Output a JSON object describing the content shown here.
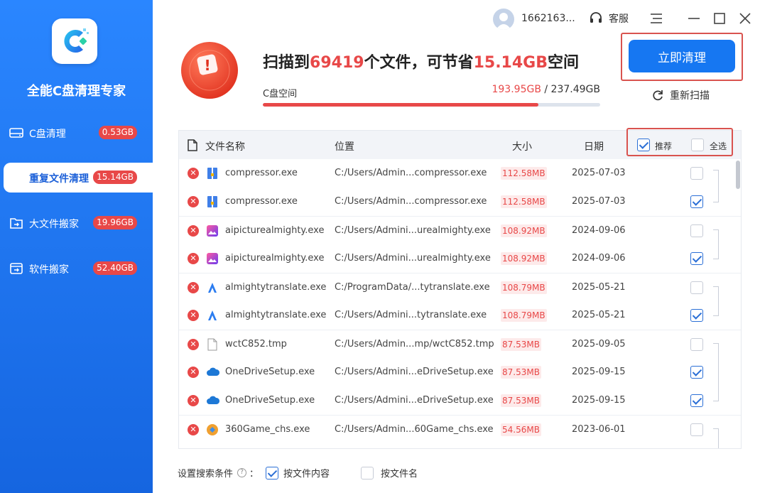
{
  "sidebar": {
    "app_name": "全能C盘清理专家",
    "items": [
      {
        "label": "C盘清理",
        "badge": "0.53GB"
      },
      {
        "label": "重复文件清理",
        "badge": "15.14GB"
      },
      {
        "label": "大文件搬家",
        "badge": "19.96GB"
      },
      {
        "label": "软件搬家",
        "badge": "52.40GB"
      }
    ]
  },
  "topbar": {
    "username": "1662163...",
    "service_label": "客服"
  },
  "summary": {
    "prefix": "扫描到",
    "file_count": "69419",
    "middle": "个文件，可节省",
    "saving": "15.14GB",
    "suffix": "空间",
    "disk_label": "C盘空间",
    "disk_used": "193.95GB",
    "disk_total": " / 237.49GB",
    "disk_fraction": 0.817,
    "clean_button": "立即清理",
    "rescan_label": "重新扫描"
  },
  "table": {
    "headers": {
      "name": "文件名称",
      "location": "位置",
      "size": "大小",
      "date": "日期",
      "recommend": "推荐",
      "select_all": "全选"
    },
    "rows": [
      {
        "name": "compressor.exe",
        "path": "C:/Users/Admin...compressor.exe",
        "size": "112.58MB",
        "date": "2025-07-03",
        "checked": false,
        "icon": "zip-icon"
      },
      {
        "name": "compressor.exe",
        "path": "C:/Users/Admin...compressor.exe",
        "size": "112.58MB",
        "date": "2025-07-03",
        "checked": true,
        "icon": "zip-icon"
      },
      {
        "name": "aipicturealmighty.exe",
        "path": "C:/Users/Admini...urealmighty.exe",
        "size": "108.92MB",
        "date": "2024-09-06",
        "checked": false,
        "icon": "picture-app-icon"
      },
      {
        "name": "aipicturealmighty.exe",
        "path": "C:/Users/Admini...urealmighty.exe",
        "size": "108.92MB",
        "date": "2024-09-06",
        "checked": true,
        "icon": "picture-app-icon"
      },
      {
        "name": "almightytranslate.exe",
        "path": "C:/ProgramData/...tytranslate.exe",
        "size": "108.79MB",
        "date": "2025-05-21",
        "checked": false,
        "icon": "translate-app-icon"
      },
      {
        "name": "almightytranslate.exe",
        "path": "C:/Users/Admini...tytranslate.exe",
        "size": "108.79MB",
        "date": "2025-05-21",
        "checked": true,
        "icon": "translate-app-icon"
      },
      {
        "name": "wctC852.tmp",
        "path": "C:/Users/Admin...mp/wctC852.tmp",
        "size": "87.53MB",
        "date": "2025-09-05",
        "checked": false,
        "icon": "blank-file-icon"
      },
      {
        "name": "OneDriveSetup.exe",
        "path": "C:/Users/Admini...eDriveSetup.exe",
        "size": "87.53MB",
        "date": "2025-09-15",
        "checked": true,
        "icon": "cloud-icon"
      },
      {
        "name": "OneDriveSetup.exe",
        "path": "C:/Users/Admini...eDriveSetup.exe",
        "size": "87.53MB",
        "date": "2025-09-15",
        "checked": true,
        "icon": "cloud-icon"
      },
      {
        "name": "360Game_chs.exe",
        "path": "C:/Users/Admin...60Game_chs.exe",
        "size": "54.56MB",
        "date": "2023-06-01",
        "checked": false,
        "icon": "game-icon"
      }
    ]
  },
  "footer": {
    "label": "设置搜索条件",
    "colon": "：",
    "option_content": "按文件内容",
    "option_name": "按文件名"
  },
  "colors": {
    "accent": "#1677f2",
    "danger": "#e84848",
    "sidebar": "#1f78f0"
  }
}
